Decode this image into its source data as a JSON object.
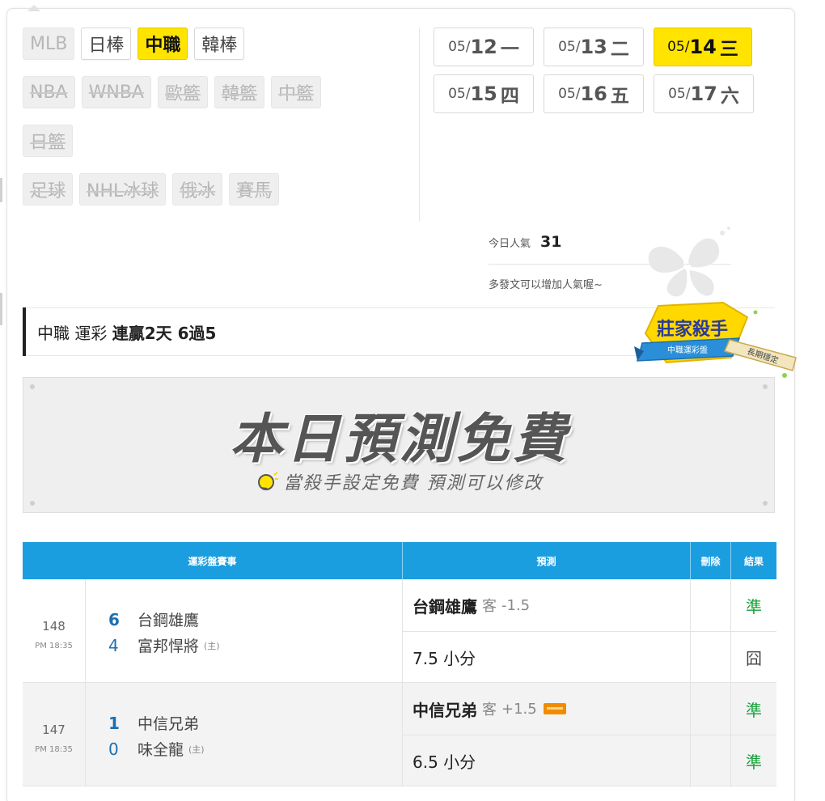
{
  "sports": {
    "rows": [
      [
        {
          "label": "MLB",
          "state": "disabled"
        },
        {
          "label": "日棒",
          "state": "enabled"
        },
        {
          "label": "中職",
          "state": "active"
        },
        {
          "label": "韓棒",
          "state": "enabled"
        }
      ],
      [
        {
          "label": "NBA",
          "state": "disabled"
        },
        {
          "label": "WNBA",
          "state": "disabled"
        },
        {
          "label": "歐籃",
          "state": "disabled"
        },
        {
          "label": "韓籃",
          "state": "disabled"
        },
        {
          "label": "中籃",
          "state": "disabled"
        }
      ],
      [
        {
          "label": "日籃",
          "state": "disabled"
        }
      ],
      [
        {
          "label": "足球",
          "state": "disabled"
        },
        {
          "label": "NHL冰球",
          "state": "disabled"
        },
        {
          "label": "俄冰",
          "state": "disabled"
        },
        {
          "label": "賽馬",
          "state": "disabled"
        }
      ]
    ]
  },
  "dates": [
    [
      {
        "md": "05/",
        "day": "12",
        "weekday": "一",
        "active": false
      },
      {
        "md": "05/",
        "day": "13",
        "weekday": "二",
        "active": false
      },
      {
        "md": "05/",
        "day": "14",
        "weekday": "三",
        "active": true
      }
    ],
    [
      {
        "md": "05/",
        "day": "15",
        "weekday": "四",
        "active": false
      },
      {
        "md": "05/",
        "day": "16",
        "weekday": "五",
        "active": false
      },
      {
        "md": "05/",
        "day": "17",
        "weekday": "六",
        "active": false
      }
    ]
  ],
  "popularity": {
    "label": "今日人氣",
    "count": "31",
    "note": "多發文可以增加人氣喔~"
  },
  "headline": {
    "league": "中職",
    "type": "運彩",
    "streak": "連贏2天 6過5"
  },
  "badge": {
    "title": "莊家殺手",
    "subtitle": "中職運彩盤",
    "ribbon": "長期穩定"
  },
  "banner": {
    "title": "本日預測免費",
    "subtitle": "當殺手設定免費  預測可以修改"
  },
  "table": {
    "headers": {
      "event": "運彩盤賽事",
      "prediction": "預測",
      "delete": "刪除",
      "result": "結果"
    },
    "games": [
      {
        "id": "148",
        "time": "PM 18:35",
        "away": {
          "score": "6",
          "team": "台鋼雄鷹"
        },
        "home": {
          "score": "4",
          "team": "富邦悍將",
          "mark": "(主)"
        },
        "picks": [
          {
            "team": "台鋼雄鷹",
            "side": "客",
            "line": "-1.5",
            "result": "準",
            "result_type": "win",
            "tag": false
          },
          {
            "team": "7.5 小分",
            "side": "",
            "line": "",
            "result": "囧",
            "result_type": "miss",
            "tag": false
          }
        ]
      },
      {
        "id": "147",
        "time": "PM 18:35",
        "away": {
          "score": "1",
          "team": "中信兄弟"
        },
        "home": {
          "score": "0",
          "team": "味全龍",
          "mark": "(主)"
        },
        "picks": [
          {
            "team": "中信兄弟",
            "side": "客",
            "line": "+1.5",
            "result": "準",
            "result_type": "win",
            "tag": true
          },
          {
            "team": "6.5 小分",
            "side": "",
            "line": "",
            "result": "準",
            "result_type": "win",
            "tag": false
          }
        ]
      }
    ]
  }
}
